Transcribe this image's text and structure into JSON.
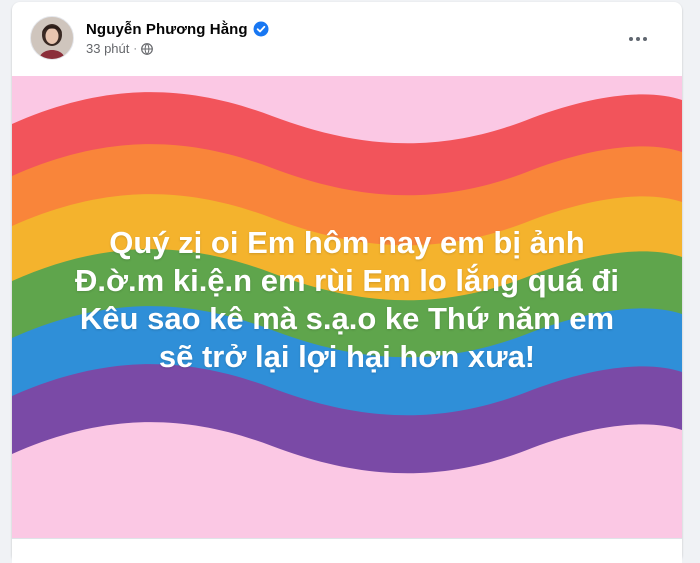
{
  "post": {
    "author": "Nguyễn Phương Hằng",
    "time": "33 phút",
    "separator": "·",
    "privacy_icon": "globe-icon",
    "verified_icon": "verified-badge-icon",
    "more_icon": "more-options-icon",
    "image_text": [
      "Quý zị oi Em hôm nay em bị ảnh",
      "Đ.ờ.m ki.ệ.n em rùi Em lo lắng quá đi",
      "Kêu sao kê mà s.ạ.o ke Thứ năm em",
      "sẽ trở lại lợi hại hơn xưa!"
    ]
  },
  "colors": {
    "background": "#f0f2f5",
    "verified_blue": "#1877f2",
    "image_background": "#fbc8e4",
    "rainbow": [
      "#f2545b",
      "#f4b32d",
      "#5fa54c",
      "#2f8fd8",
      "#7a4aa6"
    ]
  }
}
